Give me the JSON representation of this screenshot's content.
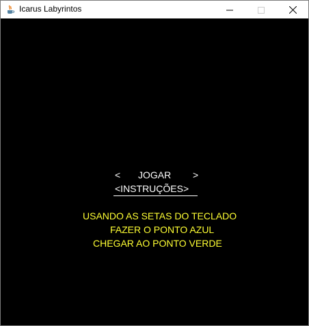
{
  "window": {
    "title": "Icarus Labyrintos",
    "controls": {
      "minimize": "minimize-icon",
      "maximize": "maximize-icon",
      "close": "close-icon"
    }
  },
  "menu": {
    "prev_arrow": "<",
    "play_label": "JOGAR",
    "next_arrow": ">",
    "instructions_label": "<INSTRUÇÕES>",
    "selected_color": "#ffffff"
  },
  "instructions": {
    "lines": [
      "USANDO AS SETAS DO TECLADO",
      "FAZER O PONTO AZUL",
      "CHEGAR AO PONTO VERDE"
    ],
    "color": "#ffff33"
  },
  "colors": {
    "background": "#000000",
    "menu_text": "#ffffff",
    "instruction_text": "#ffff33"
  }
}
